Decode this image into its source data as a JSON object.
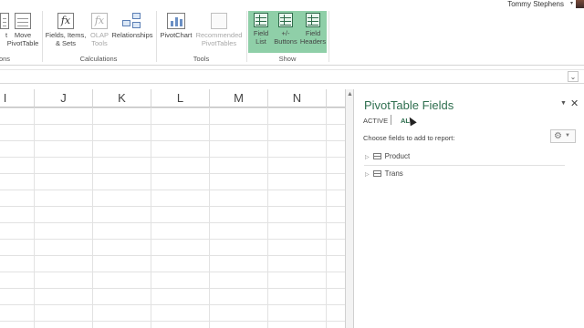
{
  "user": {
    "name": "Tommy Stephens"
  },
  "ribbon": {
    "buttons": [
      {
        "label": "Move\nPivotTable",
        "icon": "move-pivottable-icon"
      },
      {
        "label": "Fields, Items,\n& Sets",
        "icon": "fields-items-sets-icon"
      },
      {
        "label": "OLAP\nTools",
        "icon": "olap-tools-icon"
      },
      {
        "label": "Relationships",
        "icon": "relationships-icon"
      },
      {
        "label": "PivotChart",
        "icon": "pivotchart-icon"
      },
      {
        "label": "Recommended\nPivotTables",
        "icon": "recommended-pivottables-icon"
      },
      {
        "label": "Field\nList",
        "icon": "field-list-icon"
      },
      {
        "label": "+/-\nButtons",
        "icon": "plus-minus-buttons-icon"
      },
      {
        "label": "Field\nHeaders",
        "icon": "field-headers-icon"
      }
    ],
    "group_partial": "ons",
    "groups": {
      "calculations": "Calculations",
      "tools": "Tools",
      "show": "Show"
    },
    "partial_left_label": "t"
  },
  "grid": {
    "columns": [
      "I",
      "J",
      "K",
      "L",
      "M",
      "N"
    ]
  },
  "pane": {
    "title": "PivotTable Fields",
    "tabs": {
      "active": "ACTIVE",
      "all": "ALL"
    },
    "choose_label": "Choose fields to add to report:",
    "fields": [
      "Product",
      "Trans"
    ]
  },
  "colors": {
    "accent": "#2f6f4f",
    "show_group": "#8fcfa8"
  }
}
